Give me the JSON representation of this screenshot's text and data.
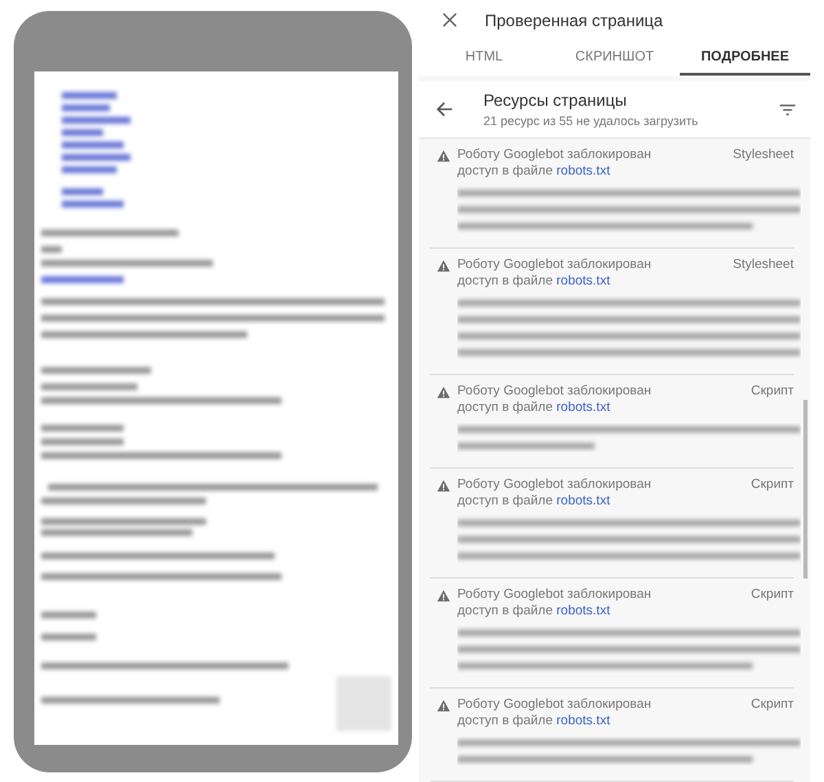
{
  "panel": {
    "title": "Проверенная страница"
  },
  "tabs": [
    {
      "label": "HTML",
      "selected": false
    },
    {
      "label": "СКРИНШОТ",
      "selected": false
    },
    {
      "label": "ПОДРОБНЕЕ",
      "selected": true
    }
  ],
  "resources": {
    "title": "Ресурсы страницы",
    "subtitle": "21 ресурс из 55 не удалось загрузить"
  },
  "items": [
    {
      "message": "Роботу Googlebot заблокирован доступ в файле",
      "link": "robots.txt",
      "type": "Stylesheet"
    },
    {
      "message": "Роботу Googlebot заблокирован доступ в файле",
      "link": "robots.txt",
      "type": "Stylesheet"
    },
    {
      "message": "Роботу Googlebot заблокирован доступ в файле",
      "link": "robots.txt",
      "type": "Скрипт"
    },
    {
      "message": "Роботу Googlebot заблокирован доступ в файле",
      "link": "robots.txt",
      "type": "Скрипт"
    },
    {
      "message": "Роботу Googlebot заблокирован доступ в файле",
      "link": "robots.txt",
      "type": "Скрипт"
    },
    {
      "message": "Роботу Googlebot заблокирован доступ в файле",
      "link": "robots.txt",
      "type": "Скрипт"
    }
  ]
}
